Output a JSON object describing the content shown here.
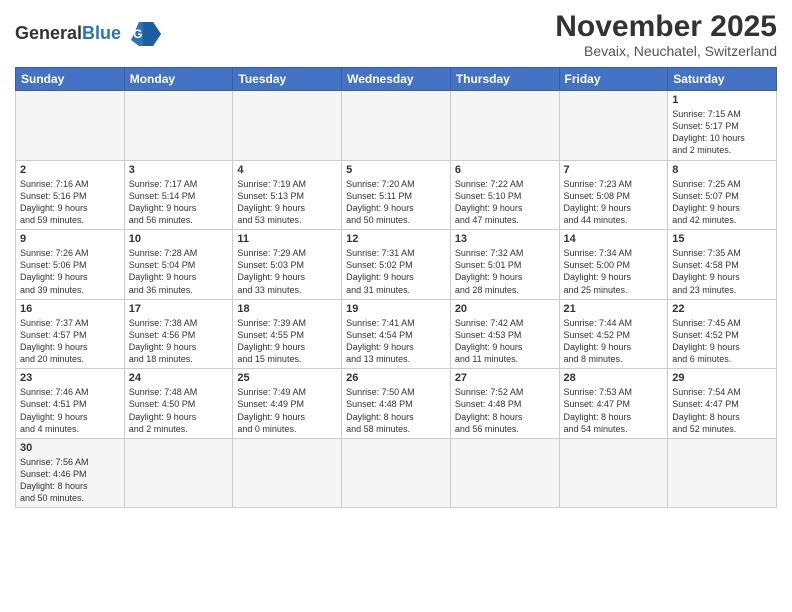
{
  "header": {
    "logo_general": "General",
    "logo_blue": "Blue",
    "month_title": "November 2025",
    "subtitle": "Bevaix, Neuchatel, Switzerland"
  },
  "weekdays": [
    "Sunday",
    "Monday",
    "Tuesday",
    "Wednesday",
    "Thursday",
    "Friday",
    "Saturday"
  ],
  "weeks": [
    [
      {
        "day": "",
        "info": "",
        "empty": true
      },
      {
        "day": "",
        "info": "",
        "empty": true
      },
      {
        "day": "",
        "info": "",
        "empty": true
      },
      {
        "day": "",
        "info": "",
        "empty": true
      },
      {
        "day": "",
        "info": "",
        "empty": true
      },
      {
        "day": "",
        "info": "",
        "empty": true
      },
      {
        "day": "1",
        "info": "Sunrise: 7:15 AM\nSunset: 5:17 PM\nDaylight: 10 hours\nand 2 minutes."
      }
    ],
    [
      {
        "day": "2",
        "info": "Sunrise: 7:16 AM\nSunset: 5:16 PM\nDaylight: 9 hours\nand 59 minutes."
      },
      {
        "day": "3",
        "info": "Sunrise: 7:17 AM\nSunset: 5:14 PM\nDaylight: 9 hours\nand 56 minutes."
      },
      {
        "day": "4",
        "info": "Sunrise: 7:19 AM\nSunset: 5:13 PM\nDaylight: 9 hours\nand 53 minutes."
      },
      {
        "day": "5",
        "info": "Sunrise: 7:20 AM\nSunset: 5:11 PM\nDaylight: 9 hours\nand 50 minutes."
      },
      {
        "day": "6",
        "info": "Sunrise: 7:22 AM\nSunset: 5:10 PM\nDaylight: 9 hours\nand 47 minutes."
      },
      {
        "day": "7",
        "info": "Sunrise: 7:23 AM\nSunset: 5:08 PM\nDaylight: 9 hours\nand 44 minutes."
      },
      {
        "day": "8",
        "info": "Sunrise: 7:25 AM\nSunset: 5:07 PM\nDaylight: 9 hours\nand 42 minutes."
      }
    ],
    [
      {
        "day": "9",
        "info": "Sunrise: 7:26 AM\nSunset: 5:06 PM\nDaylight: 9 hours\nand 39 minutes."
      },
      {
        "day": "10",
        "info": "Sunrise: 7:28 AM\nSunset: 5:04 PM\nDaylight: 9 hours\nand 36 minutes."
      },
      {
        "day": "11",
        "info": "Sunrise: 7:29 AM\nSunset: 5:03 PM\nDaylight: 9 hours\nand 33 minutes."
      },
      {
        "day": "12",
        "info": "Sunrise: 7:31 AM\nSunset: 5:02 PM\nDaylight: 9 hours\nand 31 minutes."
      },
      {
        "day": "13",
        "info": "Sunrise: 7:32 AM\nSunset: 5:01 PM\nDaylight: 9 hours\nand 28 minutes."
      },
      {
        "day": "14",
        "info": "Sunrise: 7:34 AM\nSunset: 5:00 PM\nDaylight: 9 hours\nand 25 minutes."
      },
      {
        "day": "15",
        "info": "Sunrise: 7:35 AM\nSunset: 4:58 PM\nDaylight: 9 hours\nand 23 minutes."
      }
    ],
    [
      {
        "day": "16",
        "info": "Sunrise: 7:37 AM\nSunset: 4:57 PM\nDaylight: 9 hours\nand 20 minutes."
      },
      {
        "day": "17",
        "info": "Sunrise: 7:38 AM\nSunset: 4:56 PM\nDaylight: 9 hours\nand 18 minutes."
      },
      {
        "day": "18",
        "info": "Sunrise: 7:39 AM\nSunset: 4:55 PM\nDaylight: 9 hours\nand 15 minutes."
      },
      {
        "day": "19",
        "info": "Sunrise: 7:41 AM\nSunset: 4:54 PM\nDaylight: 9 hours\nand 13 minutes."
      },
      {
        "day": "20",
        "info": "Sunrise: 7:42 AM\nSunset: 4:53 PM\nDaylight: 9 hours\nand 11 minutes."
      },
      {
        "day": "21",
        "info": "Sunrise: 7:44 AM\nSunset: 4:52 PM\nDaylight: 9 hours\nand 8 minutes."
      },
      {
        "day": "22",
        "info": "Sunrise: 7:45 AM\nSunset: 4:52 PM\nDaylight: 9 hours\nand 6 minutes."
      }
    ],
    [
      {
        "day": "23",
        "info": "Sunrise: 7:46 AM\nSunset: 4:51 PM\nDaylight: 9 hours\nand 4 minutes."
      },
      {
        "day": "24",
        "info": "Sunrise: 7:48 AM\nSunset: 4:50 PM\nDaylight: 9 hours\nand 2 minutes."
      },
      {
        "day": "25",
        "info": "Sunrise: 7:49 AM\nSunset: 4:49 PM\nDaylight: 9 hours\nand 0 minutes."
      },
      {
        "day": "26",
        "info": "Sunrise: 7:50 AM\nSunset: 4:48 PM\nDaylight: 8 hours\nand 58 minutes."
      },
      {
        "day": "27",
        "info": "Sunrise: 7:52 AM\nSunset: 4:48 PM\nDaylight: 8 hours\nand 56 minutes."
      },
      {
        "day": "28",
        "info": "Sunrise: 7:53 AM\nSunset: 4:47 PM\nDaylight: 8 hours\nand 54 minutes."
      },
      {
        "day": "29",
        "info": "Sunrise: 7:54 AM\nSunset: 4:47 PM\nDaylight: 8 hours\nand 52 minutes."
      }
    ],
    [
      {
        "day": "30",
        "info": "Sunrise: 7:56 AM\nSunset: 4:46 PM\nDaylight: 8 hours\nand 50 minutes."
      },
      {
        "day": "",
        "info": "",
        "empty": true
      },
      {
        "day": "",
        "info": "",
        "empty": true
      },
      {
        "day": "",
        "info": "",
        "empty": true
      },
      {
        "day": "",
        "info": "",
        "empty": true
      },
      {
        "day": "",
        "info": "",
        "empty": true
      },
      {
        "day": "",
        "info": "",
        "empty": true
      }
    ]
  ]
}
